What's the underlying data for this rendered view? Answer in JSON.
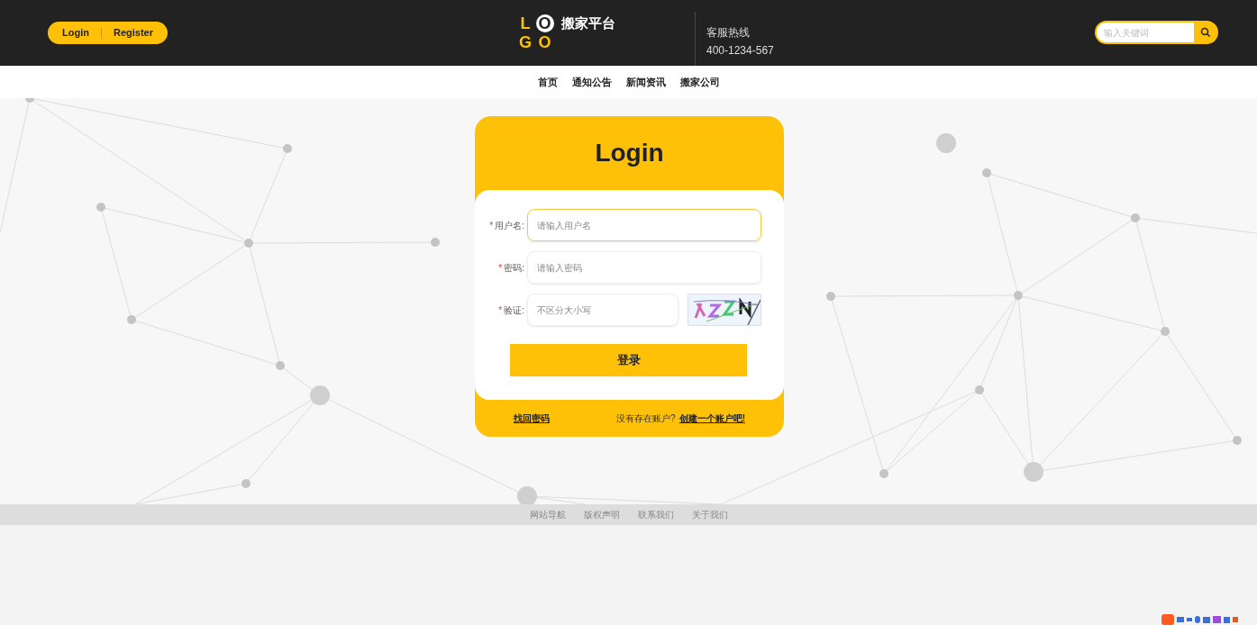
{
  "header": {
    "auth_buttons": [
      "Login",
      "Register"
    ],
    "logo": {
      "letters": [
        "L",
        "O",
        "G",
        "O"
      ],
      "site_name": "搬家平台"
    },
    "hotline": {
      "label": "客服热线",
      "number": "400-1234-567"
    },
    "search": {
      "placeholder": "输入关键词"
    }
  },
  "nav": [
    "首页",
    "通知公告",
    "新闻资讯",
    "搬家公司"
  ],
  "login_card": {
    "title": "Login",
    "fields": [
      {
        "kind": "text",
        "label": "用户名:",
        "required_mark": "*",
        "placeholder": "请输入用户名",
        "focused": true
      },
      {
        "kind": "text",
        "label": "密码:",
        "required_mark": "*",
        "placeholder": "请输入密码",
        "focused": false
      },
      {
        "kind": "captcha",
        "label": "验证:",
        "required_mark": "*",
        "placeholder": "不区分大小写",
        "focused": false
      }
    ],
    "submit": "登录",
    "forgot_link": "找回密码",
    "signup_prompt": "没有存在账户?",
    "signup_link": "创建一个账户吧!"
  },
  "footer": [
    "网站导航",
    "版权声明",
    "联系我们",
    "关于我们"
  ]
}
